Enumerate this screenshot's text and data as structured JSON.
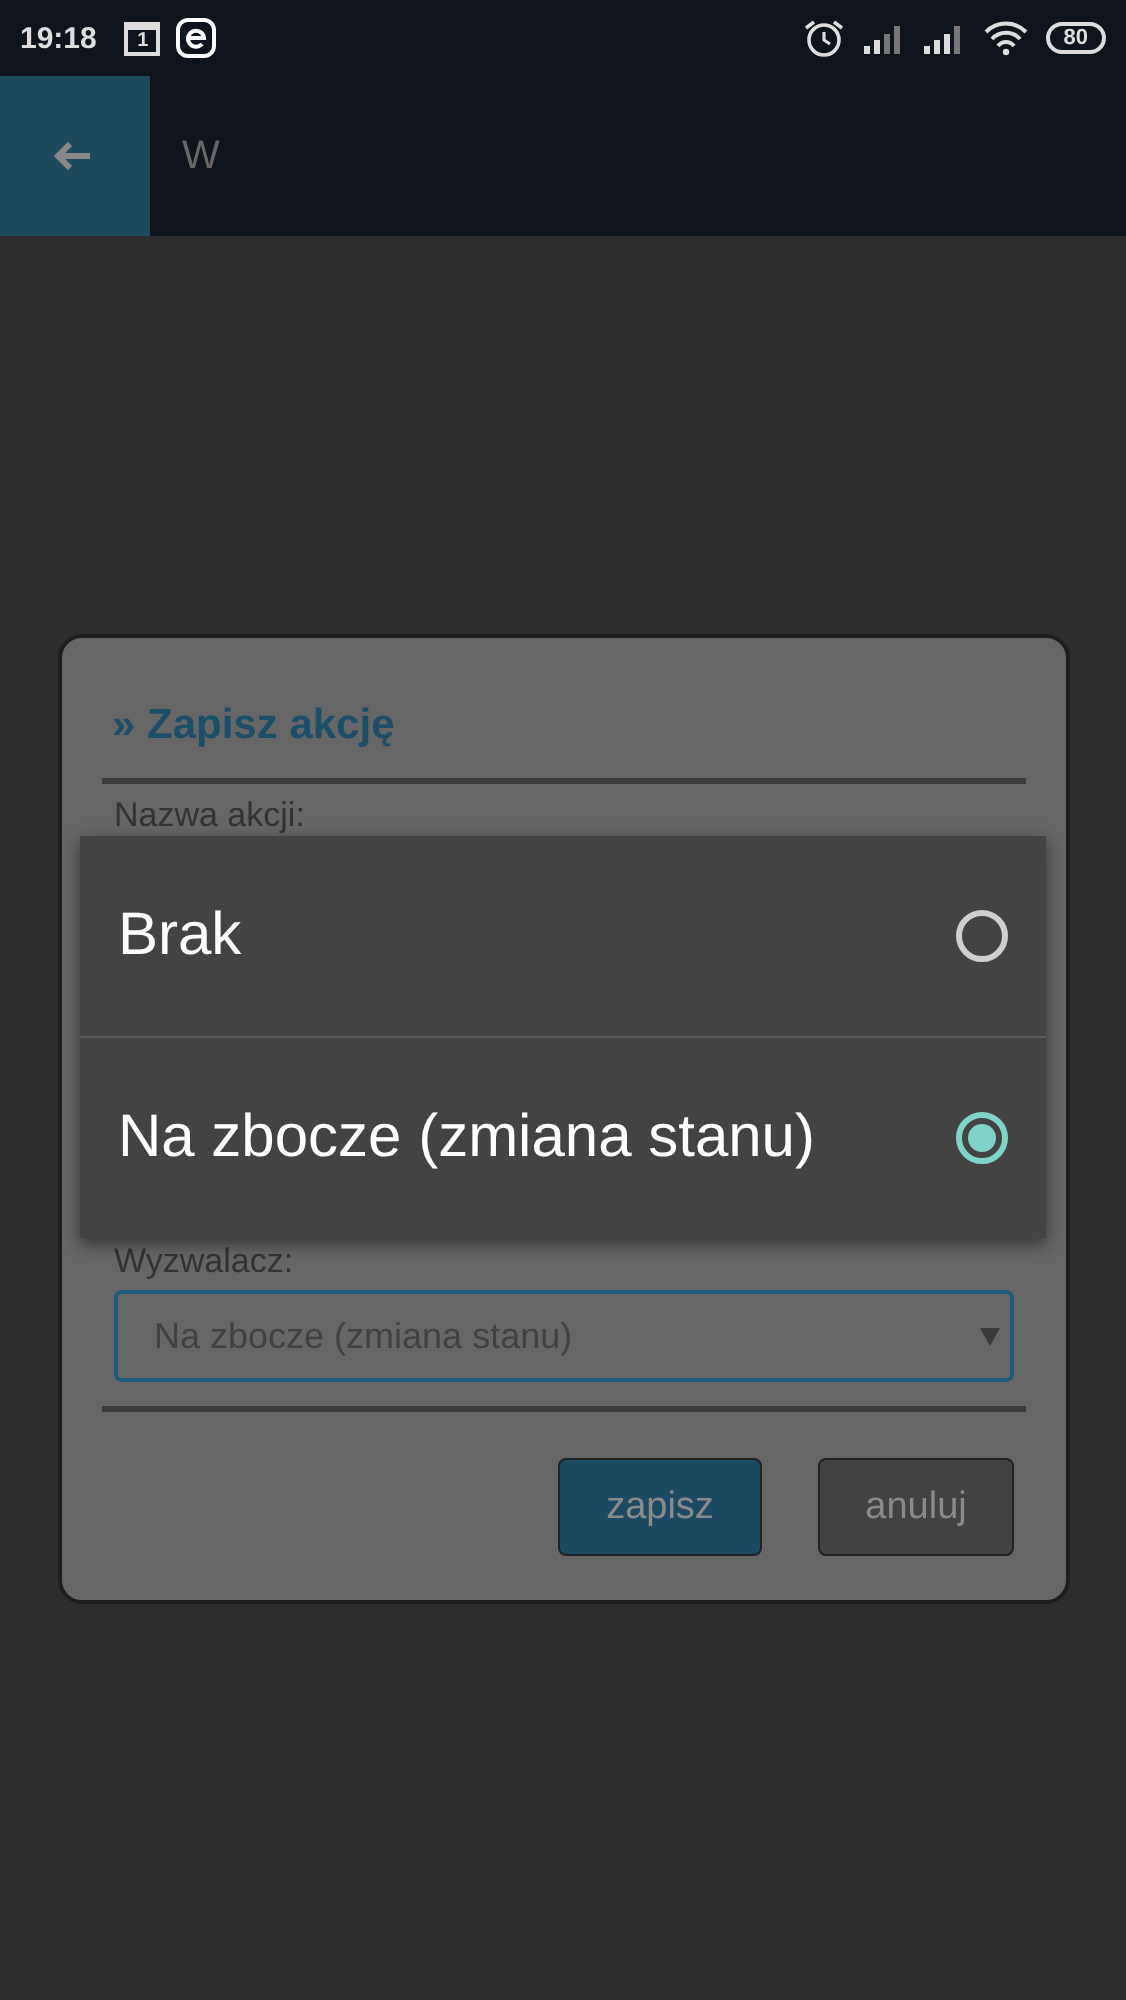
{
  "status_bar": {
    "time": "19:18",
    "calendar_day": "1",
    "battery": "80"
  },
  "header": {
    "title": "W"
  },
  "dialog": {
    "title": "» Zapisz akcję",
    "name_label": "Nazwa akcji:",
    "trigger_label": "Wyzwalacz:",
    "trigger_value": "Na zbocze (zmiana stanu)",
    "buttons": [
      {
        "label": "zapisz",
        "kind": "primary"
      },
      {
        "label": "anuluj",
        "kind": "secondary"
      }
    ]
  },
  "picker": {
    "options": [
      {
        "label": "Brak",
        "selected": false
      },
      {
        "label": "Na zbocze (zmiana stanu)",
        "selected": true
      }
    ]
  }
}
